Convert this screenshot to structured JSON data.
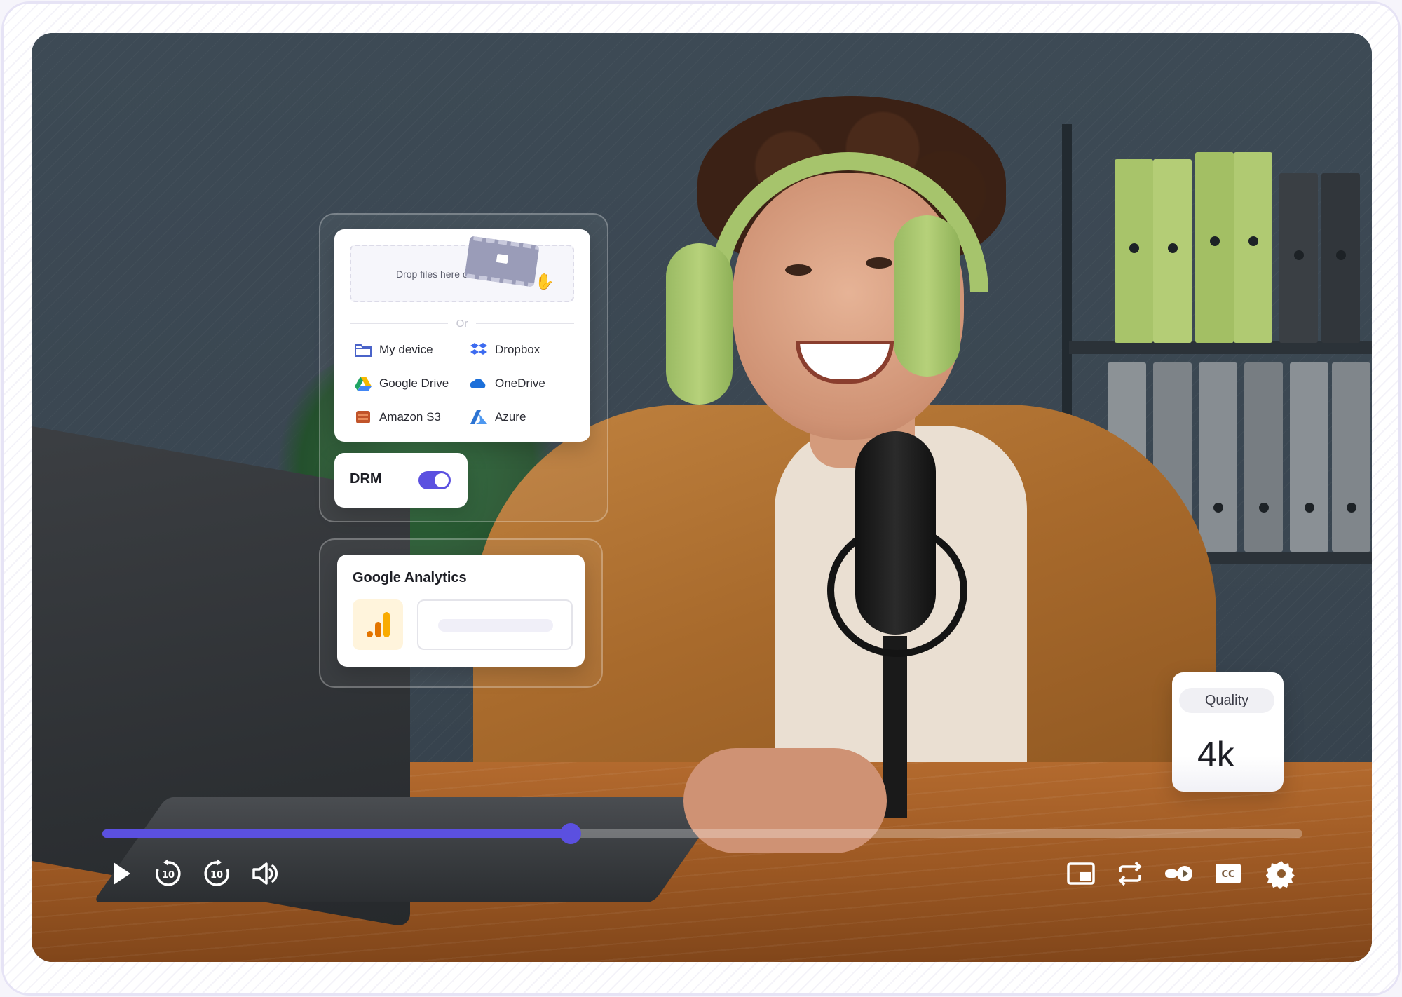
{
  "upload": {
    "dropzone_text": "Drop files here or",
    "or_label": "Or",
    "sources": [
      {
        "label": "My device",
        "icon": "folder-icon"
      },
      {
        "label": "Dropbox",
        "icon": "dropbox-icon"
      },
      {
        "label": "Google Drive",
        "icon": "google-drive-icon"
      },
      {
        "label": "OneDrive",
        "icon": "onedrive-icon"
      },
      {
        "label": "Amazon S3",
        "icon": "amazon-s3-icon"
      },
      {
        "label": "Azure",
        "icon": "azure-icon"
      }
    ]
  },
  "drm": {
    "label": "DRM",
    "enabled": true
  },
  "analytics": {
    "title": "Google Analytics"
  },
  "quality": {
    "label": "Quality",
    "value": "4k"
  },
  "player": {
    "progress": 0.39,
    "controls": [
      "play-icon",
      "rewind-10-icon",
      "forward-10-icon",
      "volume-icon",
      "picture-in-picture-icon",
      "loop-icon",
      "playback-speed-icon",
      "captions-icon",
      "settings-icon"
    ]
  },
  "colors": {
    "accent": "#5b50e0",
    "headphones": "#a6c46c"
  }
}
